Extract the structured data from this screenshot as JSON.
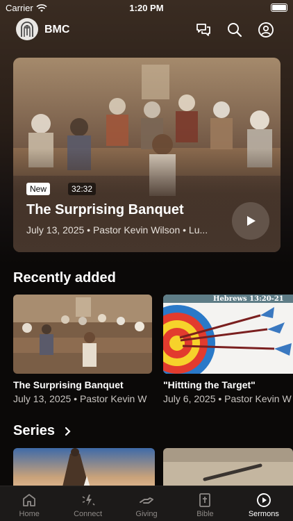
{
  "status": {
    "carrier": "Carrier",
    "time": "1:20 PM"
  },
  "header": {
    "brand": "BMC"
  },
  "hero": {
    "badge_new": "New",
    "duration": "32:32",
    "title": "The Surprising Banquet",
    "meta": "July 13, 2025 • Pastor Kevin Wilson • Lu..."
  },
  "recent": {
    "title": "Recently added",
    "cards": [
      {
        "title": "The Surprising Banquet",
        "meta": "July 13, 2025 • Pastor Kevin W"
      },
      {
        "title": "\"Hittting the Target\"",
        "meta": "July 6, 2025 • Pastor Kevin W",
        "overlay": "Hebrews 13:20-21"
      }
    ]
  },
  "series": {
    "title": "Series"
  },
  "tabs": [
    {
      "label": "Home",
      "icon": "home-icon"
    },
    {
      "label": "Connect",
      "icon": "connect-icon"
    },
    {
      "label": "Giving",
      "icon": "giving-icon"
    },
    {
      "label": "Bible",
      "icon": "bible-icon"
    },
    {
      "label": "Sermons",
      "icon": "sermons-icon",
      "active": true
    }
  ],
  "colors": {
    "accent": "#ffffff",
    "inactive_tab": "#8e8a87",
    "background": "#0b0908"
  }
}
